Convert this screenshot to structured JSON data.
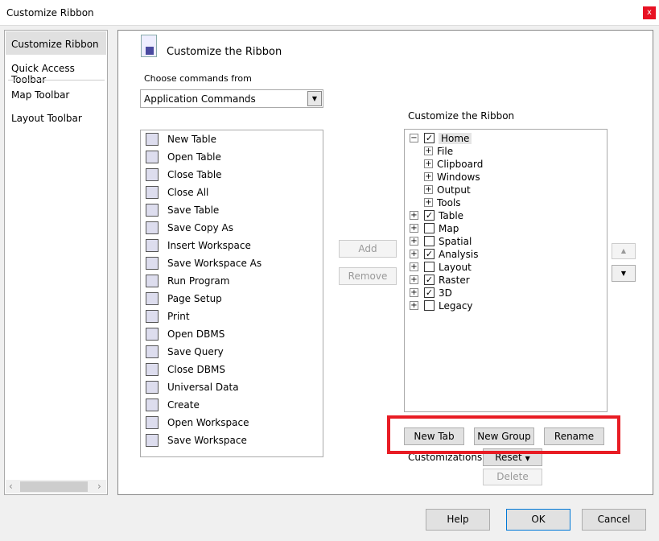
{
  "window": {
    "title": "Customize Ribbon",
    "close": "x"
  },
  "nav": {
    "items": [
      {
        "label": "Customize Ribbon",
        "selected": true
      },
      {
        "label": "Quick Access Toolbar"
      },
      {
        "label": "Map Toolbar"
      },
      {
        "label": "Layout Toolbar"
      }
    ],
    "scroll_left": "‹",
    "scroll_right": "›"
  },
  "main": {
    "heading": "Customize the Ribbon",
    "choose_label": "Choose commands from",
    "choose_value": "Application Commands",
    "ribbon_label": "Customize the Ribbon"
  },
  "commands": [
    "New Table",
    "Open Table",
    "Close Table",
    "Close All",
    "Save Table",
    "Save Copy As",
    "Insert Workspace",
    "Save Workspace As",
    "Run Program",
    "Page Setup",
    "Print",
    "Open DBMS",
    "Save Query",
    "Close DBMS",
    "Universal Data",
    "Create",
    "Open Workspace",
    "Save Workspace"
  ],
  "buttons": {
    "add": "Add",
    "remove": "Remove",
    "up": "▲",
    "down": "▼",
    "new_tab": "New Tab",
    "new_group": "New Group",
    "rename": "Rename",
    "customizations": "Customizations :",
    "reset": "Reset",
    "delete": "Delete",
    "help": "Help",
    "ok": "OK",
    "cancel": "Cancel"
  },
  "tree": [
    {
      "label": "Home",
      "level": 0,
      "expander": "−",
      "checked": true
    },
    {
      "label": "File",
      "level": 1,
      "expander": "+"
    },
    {
      "label": "Clipboard",
      "level": 1,
      "expander": "+"
    },
    {
      "label": "Windows",
      "level": 1,
      "expander": "+"
    },
    {
      "label": "Output",
      "level": 1,
      "expander": "+"
    },
    {
      "label": "Tools",
      "level": 1,
      "expander": "+"
    },
    {
      "label": "Table",
      "level": 0,
      "expander": "+",
      "checked": true
    },
    {
      "label": "Map",
      "level": 0,
      "expander": "+",
      "checked": false
    },
    {
      "label": "Spatial",
      "level": 0,
      "expander": "+",
      "checked": false
    },
    {
      "label": "Analysis",
      "level": 0,
      "expander": "+",
      "checked": true
    },
    {
      "label": "Layout",
      "level": 0,
      "expander": "+",
      "checked": false
    },
    {
      "label": "Raster",
      "level": 0,
      "expander": "+",
      "checked": true
    },
    {
      "label": "3D",
      "level": 0,
      "expander": "+",
      "checked": true
    },
    {
      "label": "Legacy",
      "level": 0,
      "expander": "+",
      "checked": false
    }
  ]
}
